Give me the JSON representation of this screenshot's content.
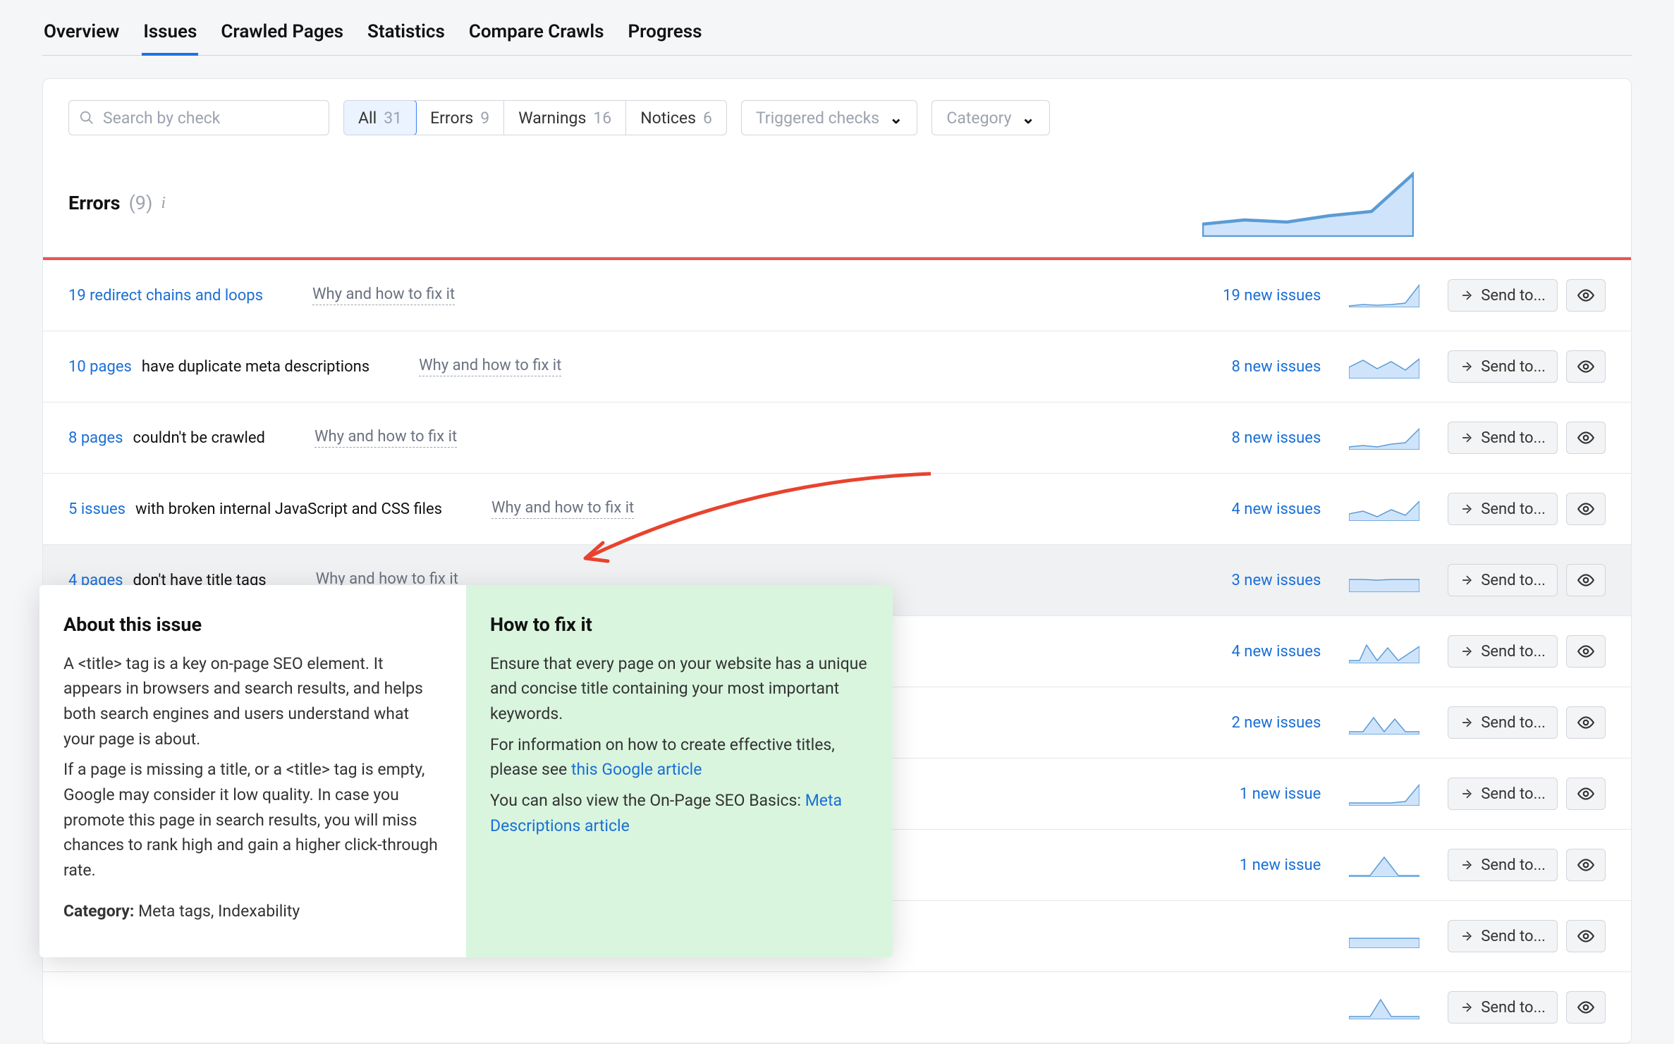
{
  "nav": {
    "tabs": [
      "Overview",
      "Issues",
      "Crawled Pages",
      "Statistics",
      "Compare Crawls",
      "Progress"
    ],
    "active": "Issues"
  },
  "toolbar": {
    "search_placeholder": "Search by check",
    "filters": [
      {
        "label": "All",
        "count": "31",
        "active": true
      },
      {
        "label": "Errors",
        "count": "9",
        "active": false
      },
      {
        "label": "Warnings",
        "count": "16",
        "active": false
      },
      {
        "label": "Notices",
        "count": "6",
        "active": false
      }
    ],
    "dropdown1": "Triggered checks",
    "dropdown2": "Category"
  },
  "section": {
    "title": "Errors",
    "count": "(9)"
  },
  "rows": [
    {
      "link": "19 redirect chains and loops",
      "plain": "",
      "fix": "Why and how to fix it",
      "new": "19 new issues"
    },
    {
      "link": "10 pages",
      "plain": "have duplicate meta descriptions",
      "fix": "Why and how to fix it",
      "new": "8 new issues"
    },
    {
      "link": "8 pages",
      "plain": "couldn't be crawled",
      "fix": "Why and how to fix it",
      "new": "8 new issues"
    },
    {
      "link": "5 issues",
      "plain": "with broken internal JavaScript and CSS files",
      "fix": "Why and how to fix it",
      "new": "4 new issues"
    },
    {
      "link": "4 pages",
      "plain": "don't have title tags",
      "fix": "Why and how to fix it",
      "new": "3 new issues",
      "highlight": true
    },
    {
      "link": "",
      "plain": "",
      "fix": "",
      "new": "4 new issues"
    },
    {
      "link": "",
      "plain": "",
      "fix": "",
      "new": "2 new issues"
    },
    {
      "link": "",
      "plain": "",
      "fix": "",
      "new": "1 new issue"
    },
    {
      "link": "",
      "plain": "",
      "fix": "",
      "new": "1 new issue"
    },
    {
      "link": "",
      "plain": "",
      "fix": "",
      "new": ""
    },
    {
      "link": "",
      "plain": "",
      "fix": "",
      "new": ""
    }
  ],
  "sendto": "Send to...",
  "popover": {
    "about_title": "About this issue",
    "about_p1": "A <title> tag is a key on-page SEO element. It appears in browsers and search results, and helps both search engines and users understand what your page is about.",
    "about_p2": "If a page is missing a title, or a <title> tag is empty, Google may consider it low quality. In case you promote this page in search results, you will miss chances to rank high and gain a higher click-through rate.",
    "cat_label": "Category:",
    "cat_val": "Meta tags, Indexability",
    "fix_title": "How to fix it",
    "fix_p1": "Ensure that every page on your website has a unique and concise title containing your most important keywords.",
    "fix_p2a": "For information on how to create effective titles, please see ",
    "fix_p2_link": "this Google article",
    "fix_p3a": "You can also view the On-Page SEO Basics: ",
    "fix_p3_link": "Meta Descriptions article"
  },
  "sparks": [
    "M0,28 L20,26 L40,27 L60,24 L80,22 L100,4",
    "M0,32 L20,30 L40,31 L60,30 L80,28 L100,2",
    "M0,18 L20,8 L40,20 L60,10 L80,22 L100,6",
    "M0,30 L20,28 L40,30 L60,26 L80,24 L100,4",
    "M0,24 L20,20 L40,28 L60,18 L80,26 L100,6",
    "M0,16 L20,16 L40,17 L60,16 L80,16 L100,16",
    "M0,30 L15,30 L25,8 L40,30 L55,12 L70,30 L100,10",
    "M0,30 L20,30 L35,10 L50,30 L65,12 L80,30 L100,30",
    "M0,30 L20,30 L40,30 L60,30 L80,28 L100,4",
    "M0,32 L30,32 L50,6 L70,32 L100,32",
    "M0,20 L100,20",
    "M0,30 L30,30 L45,6 L60,30 L100,30"
  ]
}
